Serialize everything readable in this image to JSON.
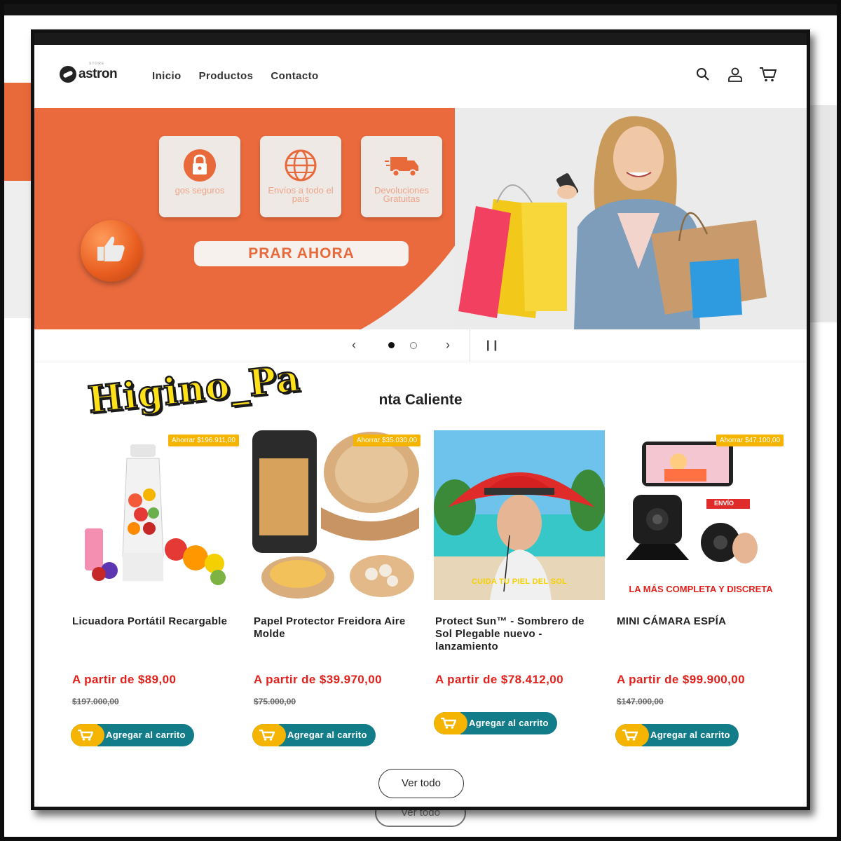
{
  "watermark": "Higino_Pa",
  "background": {
    "ghost_button_label": "Ver todo"
  },
  "header": {
    "logo_text": "astron",
    "logo_sub": "STORE",
    "nav": [
      "Inicio",
      "Productos",
      "Contacto"
    ],
    "icons": [
      "search-icon",
      "account-icon",
      "cart-icon"
    ]
  },
  "hero": {
    "features": [
      {
        "icon": "lock-icon",
        "label": "gos seguros"
      },
      {
        "icon": "globe-icon",
        "label": "Envíos a todo el país"
      },
      {
        "icon": "truck-icon",
        "label": "Devoluciones Gratuitas"
      }
    ],
    "cta_label": "PRAR AHORA"
  },
  "carousel": {
    "slides": 2,
    "active": 1
  },
  "section_title": "nta Caliente",
  "products": [
    {
      "name": "Licuadora Portátil Recargable",
      "badge": "Ahorrar $196.911,00",
      "price": "A partir de $89,00",
      "old_price": "$197.000,00",
      "button": "Agregar al carrito"
    },
    {
      "name": "Papel Protector Freidora Aire Molde",
      "badge": "Ahorrar $35.030,00",
      "price": "A partir de $39.970,00",
      "old_price": "$75.000,00",
      "button": "Agregar al carrito"
    },
    {
      "name": "Protect Sun™ - Sombrero de Sol Plegable nuevo - lanzamiento",
      "image_caption": "CUIDA TU PIEL DEL SOL",
      "price": "A partir de $78.412,00",
      "button": "Agregar al carrito"
    },
    {
      "name": "MINI CÁMARA ESPÍA",
      "badge": "Ahorrar $47.100,00",
      "image_caption": "LA MÁS COMPLETA Y DISCRETA",
      "image_tag": "ENVÍO",
      "price": "A partir de $99.900,00",
      "old_price": "$147.000,00",
      "button": "Agregar al carrito"
    }
  ],
  "view_all_label": "Ver todo",
  "colors": {
    "orange": "#e8693a",
    "price_red": "#e3201b",
    "button_teal": "#127d88",
    "badge_yellow": "#f5b400"
  }
}
